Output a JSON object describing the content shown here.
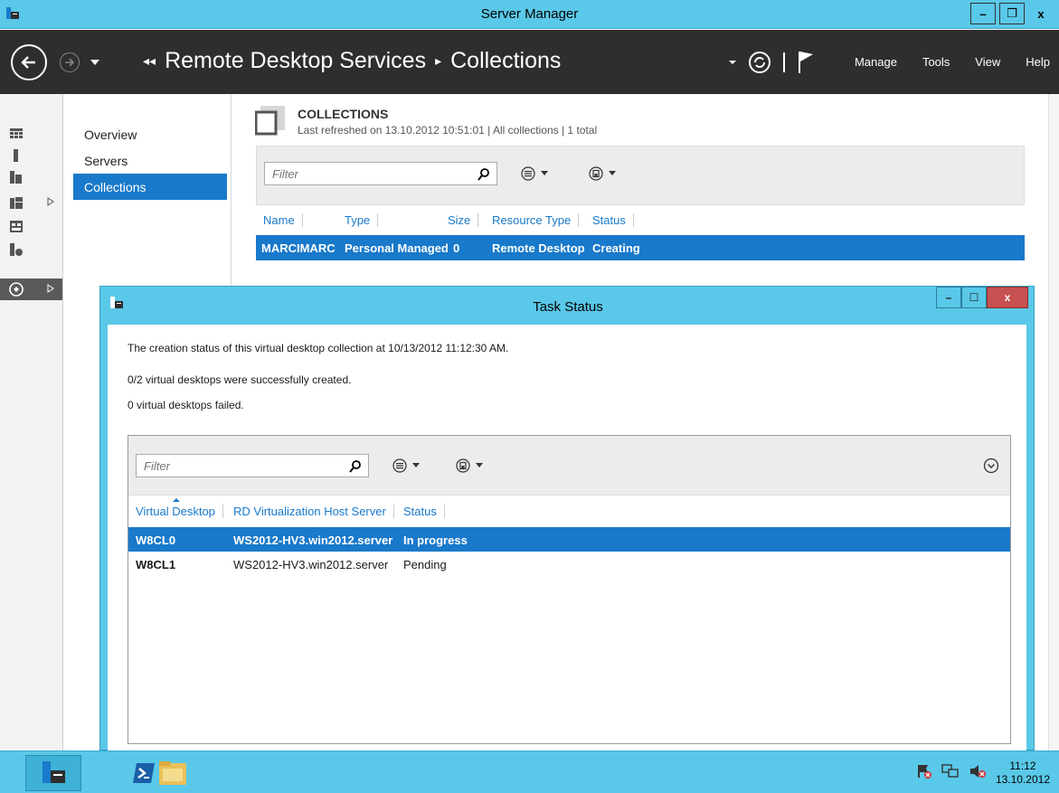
{
  "window": {
    "title": "Server Manager",
    "minimize": "–",
    "maximize": "❐",
    "close": "x"
  },
  "header": {
    "breadcrumb_lead": "◂◂",
    "breadcrumb": [
      "Remote Desktop Services",
      "Collections"
    ],
    "breadcrumb_sep": "▸",
    "menus": [
      "Manage",
      "Tools",
      "View",
      "Help"
    ]
  },
  "subnav": {
    "items": [
      "Overview",
      "Servers",
      "Collections"
    ],
    "active_index": 2
  },
  "collections": {
    "title": "COLLECTIONS",
    "subtitle": "Last refreshed on 13.10.2012 10:51:01 | All collections | 1 total",
    "filter_placeholder": "Filter",
    "columns": [
      "Name",
      "Type",
      "Size",
      "Resource Type",
      "Status"
    ],
    "rows": [
      {
        "name": "MARCIMARC",
        "type": "Personal Managed",
        "size": "0",
        "resource_type": "Remote Desktop",
        "status": "Creating"
      }
    ]
  },
  "dialog": {
    "title": "Task Status",
    "minimize": "–",
    "maximize": "☐",
    "close": "x",
    "messages": [
      "The creation status of this virtual desktop collection at 10/13/2012 11:12:30 AM.",
      "0/2 virtual desktops were successfully created.",
      "0 virtual desktops failed."
    ],
    "filter_placeholder": "Filter",
    "columns": [
      "Virtual Desktop",
      "RD Virtualization Host Server",
      "Status"
    ],
    "rows": [
      {
        "desktop": "W8CL0",
        "host": "WS2012-HV3.win2012.server",
        "status": "In progress"
      },
      {
        "desktop": "W8CL1",
        "host": "WS2012-HV3.win2012.server",
        "status": "Pending"
      }
    ],
    "selected_row": 0
  },
  "taskbar": {
    "time": "11:12",
    "date": "13.10.2012"
  },
  "colors": {
    "accent": "#1979ca",
    "chrome": "#5ac8e8",
    "header": "#2e2e2e"
  }
}
